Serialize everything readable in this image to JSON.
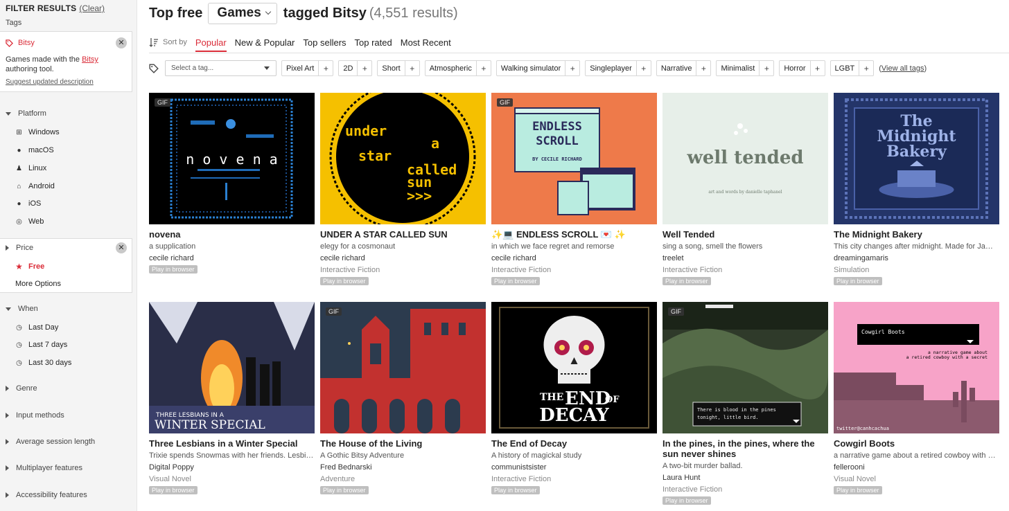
{
  "sidebar": {
    "filter_title": "FILTER RESULTS",
    "clear_label": "(Clear)",
    "tags_label": "Tags",
    "bitsy": {
      "tag": "Bitsy",
      "desc_prefix": "Games made with the ",
      "desc_link": "Bitsy",
      "desc_suffix": " authoring tool.",
      "suggest": "Suggest updated description"
    },
    "platform": {
      "label": "Platform",
      "items": [
        "Windows",
        "macOS",
        "Linux",
        "Android",
        "iOS",
        "Web"
      ]
    },
    "price": {
      "label": "Price",
      "selected": "Free",
      "more": "More Options"
    },
    "when": {
      "label": "When",
      "items": [
        "Last Day",
        "Last 7 days",
        "Last 30 days"
      ]
    },
    "collapsed": [
      "Genre",
      "Input methods",
      "Average session length",
      "Multiplayer features",
      "Accessibility features"
    ],
    "close_glyph": "✕"
  },
  "header": {
    "top_free": "Top free",
    "games": "Games",
    "tagged": "tagged Bitsy",
    "count": "(4,551 results)"
  },
  "sort": {
    "label": "Sort by",
    "tabs": [
      "Popular",
      "New & Popular",
      "Top sellers",
      "Top rated",
      "Most Recent"
    ]
  },
  "tags": {
    "placeholder": "Select a tag...",
    "items": [
      "Pixel Art",
      "2D",
      "Short",
      "Atmospheric",
      "Walking simulator",
      "Singleplayer",
      "Narrative",
      "Minimalist",
      "Horror",
      "LGBT"
    ],
    "plus": "+",
    "view_all": "View all tags"
  },
  "games": [
    {
      "title": "novena",
      "desc": "a supplication",
      "author": "cecile richard",
      "genre": "",
      "badge": "Play in browser",
      "gif": "GIF",
      "art": "novena",
      "art_text": "n o v e n a"
    },
    {
      "title": "UNDER A STAR CALLED SUN",
      "desc": "elegy for a cosmonaut",
      "author": "cecile richard",
      "genre": "Interactive Fiction",
      "badge": "Play in browser",
      "gif": "",
      "art": "star",
      "art_lines": [
        "under",
        "a",
        "star",
        "called",
        "sun"
      ],
      "art_arrows": ">>>"
    },
    {
      "title": "✨💻 ENDLESS SCROLL 💌 ✨",
      "desc": "in which we face regret and remorse",
      "author": "cecile richard",
      "genre": "Interactive Fiction",
      "badge": "Play in browser",
      "gif": "GIF",
      "art": "scroll",
      "art_lines": [
        "ENDLESS",
        "SCROLL",
        "BY CECILE RICHARD"
      ]
    },
    {
      "title": "Well Tended",
      "desc": "sing a song, smell the flowers",
      "author": "treelet",
      "genre": "Interactive Fiction",
      "badge": "Play in browser",
      "gif": "",
      "art": "tended",
      "art_lines": [
        "well tended",
        "art and words by danielle taphanel"
      ]
    },
    {
      "title": "The Midnight Bakery",
      "desc": "This city changes after midnight. Made for Jam…",
      "author": "dreamingamaris",
      "genre": "Simulation",
      "badge": "Play in browser",
      "gif": "",
      "art": "bakery",
      "art_lines": [
        "The",
        "Midnight",
        "Bakery"
      ]
    },
    {
      "title": "Three Lesbians in a Winter Special",
      "desc": "Trixie spends Snowmas with her friends. Lesbia…",
      "author": "Digital Poppy",
      "genre": "Visual Novel",
      "badge": "Play in browser",
      "gif": "",
      "art": "winter",
      "art_lines": [
        "THREE LESBIANS IN A",
        "WINTER SPECIAL"
      ]
    },
    {
      "title": "The House of the Living",
      "desc": "A Gothic Bitsy Adventure",
      "author": "Fred Bednarski",
      "genre": "Adventure",
      "badge": "Play in browser",
      "gif": "GIF",
      "art": "house"
    },
    {
      "title": "The End of Decay",
      "desc": "A history of magickal study",
      "author": "communistsister",
      "genre": "Interactive Fiction",
      "badge": "Play in browser",
      "gif": "",
      "art": "decay",
      "art_lines": [
        "THE",
        "END",
        "OF",
        "DECAY"
      ]
    },
    {
      "title": "In the pines, in the pines, where the sun never shines",
      "desc": "A two-bit murder ballad.",
      "author": "Laura Hunt",
      "genre": "Interactive Fiction",
      "badge": "Play in browser",
      "gif": "GIF",
      "art": "pines",
      "art_lines": [
        "There is blood in the pines",
        "tonight, little bird."
      ]
    },
    {
      "title": "Cowgirl Boots",
      "desc": "a narrative game about a retired cowboy with a …",
      "author": "fellerooni",
      "genre": "Visual Novel",
      "badge": "Play in browser",
      "gif": "",
      "art": "cowgirl",
      "art_lines": [
        "Cowgirl Boots",
        "a narrative game about",
        "a retired cowboy with a secret",
        "twitter@canhcachua"
      ]
    }
  ]
}
